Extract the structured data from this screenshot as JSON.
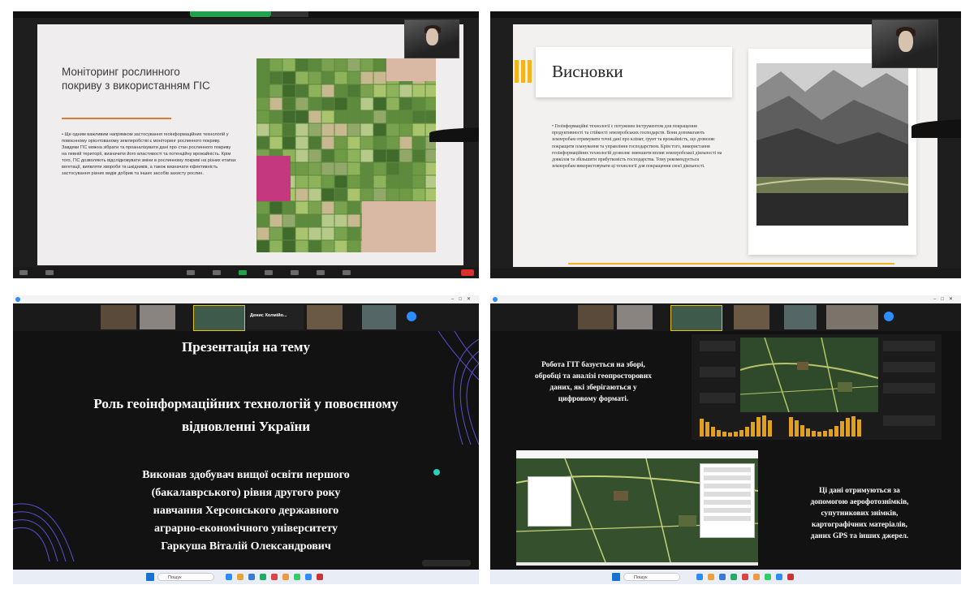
{
  "pane1": {
    "slide_title": "Моніторинг рослинного покриву з використанням ГІС",
    "slide_body": "• Ще одним важливим напрямком застосування геоінформаційних технологій у повоєнному орієнтованому землеробстві є моніторинг рослинного покриву. Завдяки ГІС можна зібрати та проаналізувати дані про стан рослинного покриву на певній території, визначити його властивості та потенційну врожайність. Крім того, ГІС дозволяють відслідковувати зміни в рослинному покриві на різних етапах вегетації, виявляти хвороби та шкідників, а також визначати ефективність застосування різних видів добрив та інших засобів захисту рослин."
  },
  "pane2": {
    "slide_title": "Висновки",
    "slide_body": "• Геоінформаційні технології є потужним інструментом для покращення продуктивності та стійкості землеробських господарств. Вони допомагають землеробам отримувати точні дані про клімат, ґрунт та врожайність, що дозволяє покращити планування та управління господарством. Крім того, використання геоінформаційних технологій дозволяє зменшити вплив землеробської діяльності на довкілля та збільшити прибутковість господарства. Тому рекомендується землеробам використовувати ці технології для покращення своєї діяльності."
  },
  "pane3": {
    "line1": "Презентація на тему",
    "line2a": "Роль геоінформаційних технологій у повоєнному",
    "line2b": "відновленні України",
    "line3": "Виконав здобувач вищої освіти першого",
    "line4": "(бакалаврського) рівня другого року",
    "line5": "навчання Херсонського державного",
    "line6": "аграрно-економічного університету",
    "line7": "Гаркуша Віталій Олександрович",
    "speaker_label": "Денис Холмійо...",
    "taskbar_search": "Пошук"
  },
  "pane4": {
    "text_top_1": "Робота ГІТ базується на зборі,",
    "text_top_2": "обробці та аналізі геопросторових",
    "text_top_3": "даних, які зберігаються у",
    "text_top_4": "цифровому форматі.",
    "text_bot_1": "Ці дані отримуються за",
    "text_bot_2": "допомогою аерофотознімків,",
    "text_bot_3": "супутникових знімків,",
    "text_bot_4": "картографічних матеріалів,",
    "text_bot_5": "даних GPS та інших джерел.",
    "taskbar_search": "Пошук"
  },
  "colors": {
    "accent_orange": "#e27a2d",
    "accent_yellow": "#f3b51f",
    "zoom_green": "#1fa34a",
    "end_red": "#d9322b"
  }
}
